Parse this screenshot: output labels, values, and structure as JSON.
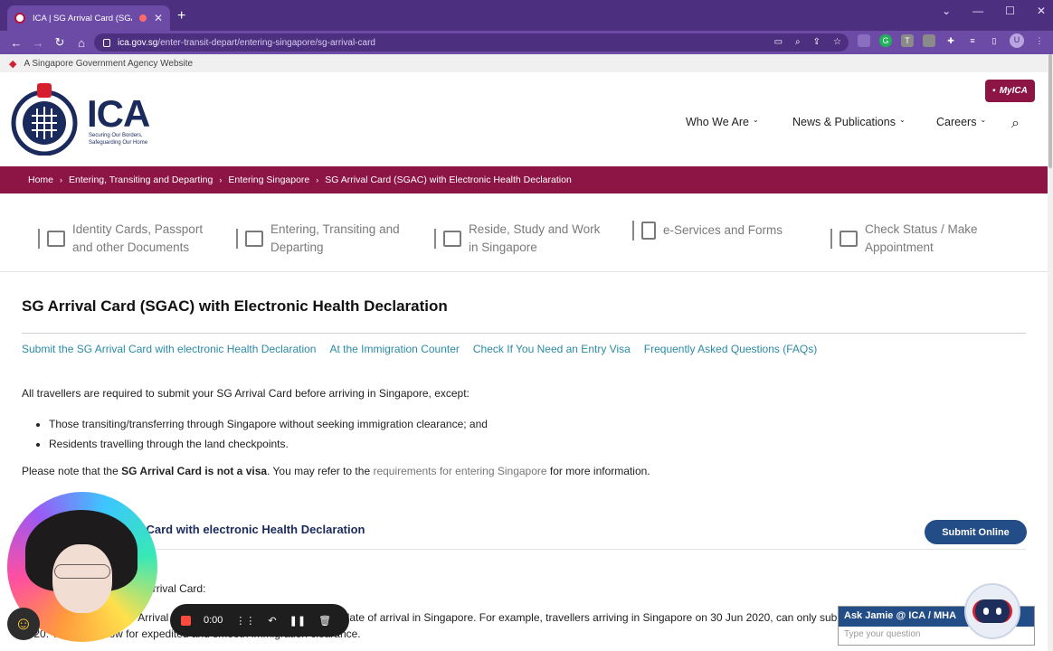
{
  "browser": {
    "tab_title": "ICA | SG Arrival Card (SGAC)",
    "new_tab": "+",
    "url_host": "ica.gov.sg",
    "url_path": "/enter-transit-depart/entering-singapore/sg-arrival-card",
    "avatar_letter": "U",
    "ext_g": "G",
    "ext_t": "T"
  },
  "gov_banner": "A Singapore Government Agency Website",
  "header": {
    "logo_text": "ICA",
    "tagline": "Securing Our Borders, Safeguarding Our Home",
    "myica": "MyICA",
    "nav": [
      "Who We Are",
      "News & Publications",
      "Careers"
    ]
  },
  "breadcrumb": [
    "Home",
    "Entering, Transiting and Departing",
    "Entering Singapore",
    "SG Arrival Card (SGAC) with Electronic Health Declaration"
  ],
  "categories": [
    {
      "line1": "Identity Cards, Passport",
      "line2": "and other Documents"
    },
    {
      "line1": "Entering, Transiting and",
      "line2": "Departing"
    },
    {
      "line1": "Reside, Study and Work",
      "line2": "in Singapore"
    },
    {
      "line1": "e-Services and Forms",
      "line2": ""
    },
    {
      "line1": "Check Status / Make",
      "line2": "Appointment"
    }
  ],
  "content": {
    "title": "SG Arrival Card (SGAC) with Electronic Health Declaration",
    "anchors": [
      "Submit the SG Arrival Card with electronic Health Declaration",
      "At the Immigration Counter",
      "Check If You Need an Entry Visa",
      "Frequently Asked Questions (FAQs)"
    ],
    "intro": "All travellers are required to submit your SG Arrival Card before arriving in Singapore, except:",
    "bullets": [
      "Those transiting/transferring through Singapore without seeking immigration clearance; and",
      "Residents travelling through the land checkpoints."
    ],
    "note_prefix": "Please note that the ",
    "note_bold": "SG Arrival Card is not a visa",
    "note_mid": ". You may refer to the ",
    "note_link": "requirements for entering Singapore",
    "note_suffix": " for more information.",
    "section_title": "Submit the SG Arrival Card with electronic Health Declaration",
    "submit_button": "Submit Online",
    "section_intro": "Before submitting the SG Arrival Card:",
    "section_p1": "You may submit the SG Arrival Card within three days prior to your date of arrival in Singapore. For example, travellers arriving in Singapore on 30 Jun 2020, can only submit their SG Arrival Card from 27 Jun 2020. This is to allow for expedited and smooth immigration clearance."
  },
  "recorder": {
    "time": "0:00"
  },
  "chat": {
    "title": "Ask Jamie @ ICA / MHA",
    "placeholder": "Type your question"
  },
  "colors": {
    "brand": "#8d1545",
    "chrome": "#6c4ba6",
    "link": "#2a8aa5",
    "button": "#234d86"
  }
}
